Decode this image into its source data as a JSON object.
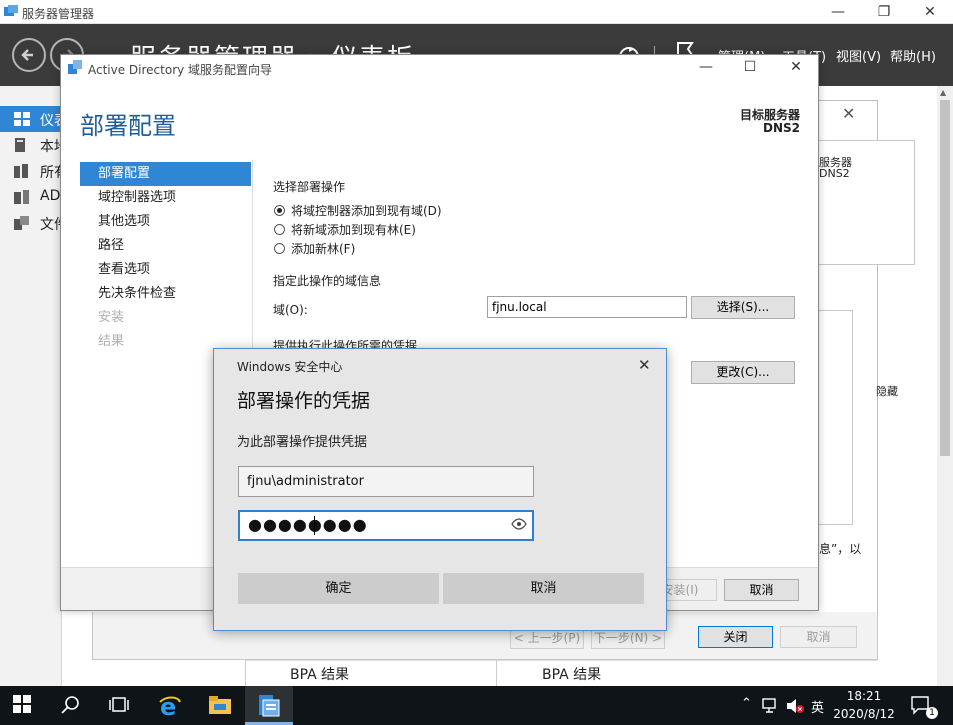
{
  "server_manager": {
    "title": "服务器管理器",
    "breadcrumb": "服务器管理器 › 仪表板",
    "menus": [
      "管理(M)",
      "工具(T)",
      "视图(V)",
      "帮助(H)"
    ],
    "sidebar": [
      {
        "label": "仪表",
        "icon": "dashboard-icon"
      },
      {
        "label": "本地",
        "icon": "local-server-icon"
      },
      {
        "label": "所有",
        "icon": "all-servers-icon"
      },
      {
        "label": "AD",
        "icon": "ad-ds-icon"
      },
      {
        "label": "文件",
        "icon": "file-services-icon"
      }
    ]
  },
  "background_popup": {
    "line1": "服务器",
    "line2": "DNS2",
    "hidden_text": "隐藏",
    "tail_text": "息”，以"
  },
  "background_wizard": {
    "prev": "< 上一步(P)",
    "next": "下一步(N) >",
    "close": "关闭",
    "cancel": "取消"
  },
  "bpa": [
    "BPA 结果",
    "BPA 结果"
  ],
  "wizard": {
    "title": "Active Directory 域服务配置向导",
    "heading": "部署配置",
    "target_label": "目标服务器",
    "target_value": "DNS2",
    "nav": [
      {
        "label": "部署配置",
        "state": "active"
      },
      {
        "label": "域控制器选项",
        "state": "normal"
      },
      {
        "label": "其他选项",
        "state": "normal"
      },
      {
        "label": "路径",
        "state": "normal"
      },
      {
        "label": "查看选项",
        "state": "normal"
      },
      {
        "label": "先决条件检查",
        "state": "normal"
      },
      {
        "label": "安装",
        "state": "disabled"
      },
      {
        "label": "结果",
        "state": "disabled"
      }
    ],
    "select_op_label": "选择部署操作",
    "options": [
      {
        "label": "将域控制器添加到现有域(D)",
        "checked": true
      },
      {
        "label": "将新域添加到现有林(E)",
        "checked": false
      },
      {
        "label": "添加新林(F)",
        "checked": false
      }
    ],
    "domain_info_label": "指定此操作的域信息",
    "domain_label": "域(O):",
    "domain_value": "fjnu.local",
    "select_button": "选择(S)...",
    "credentials_label": "提供执行此操作所需的凭据",
    "change_button": "更改(C)...",
    "install_button": "安装(I)",
    "cancel_button": "取消"
  },
  "security": {
    "title": "Windows 安全中心",
    "heading": "部署操作的凭据",
    "subtitle": "为此部署操作提供凭据",
    "username": "fjnu\\administrator",
    "password_mask": "●●●●●●●●",
    "ok": "确定",
    "cancel": "取消"
  },
  "taskbar": {
    "icons": [
      "start-icon",
      "search-icon",
      "task-view-icon",
      "ie-icon",
      "file-explorer-icon",
      "server-manager-icon"
    ],
    "ime": "英",
    "time": "18:21",
    "date": "2020/8/12",
    "notifications": "1"
  },
  "colors": {
    "accent": "#2f86d4",
    "header": "#3b3b3b",
    "taskbar": "#0f1419",
    "wizard_heading": "#1e5e99"
  }
}
